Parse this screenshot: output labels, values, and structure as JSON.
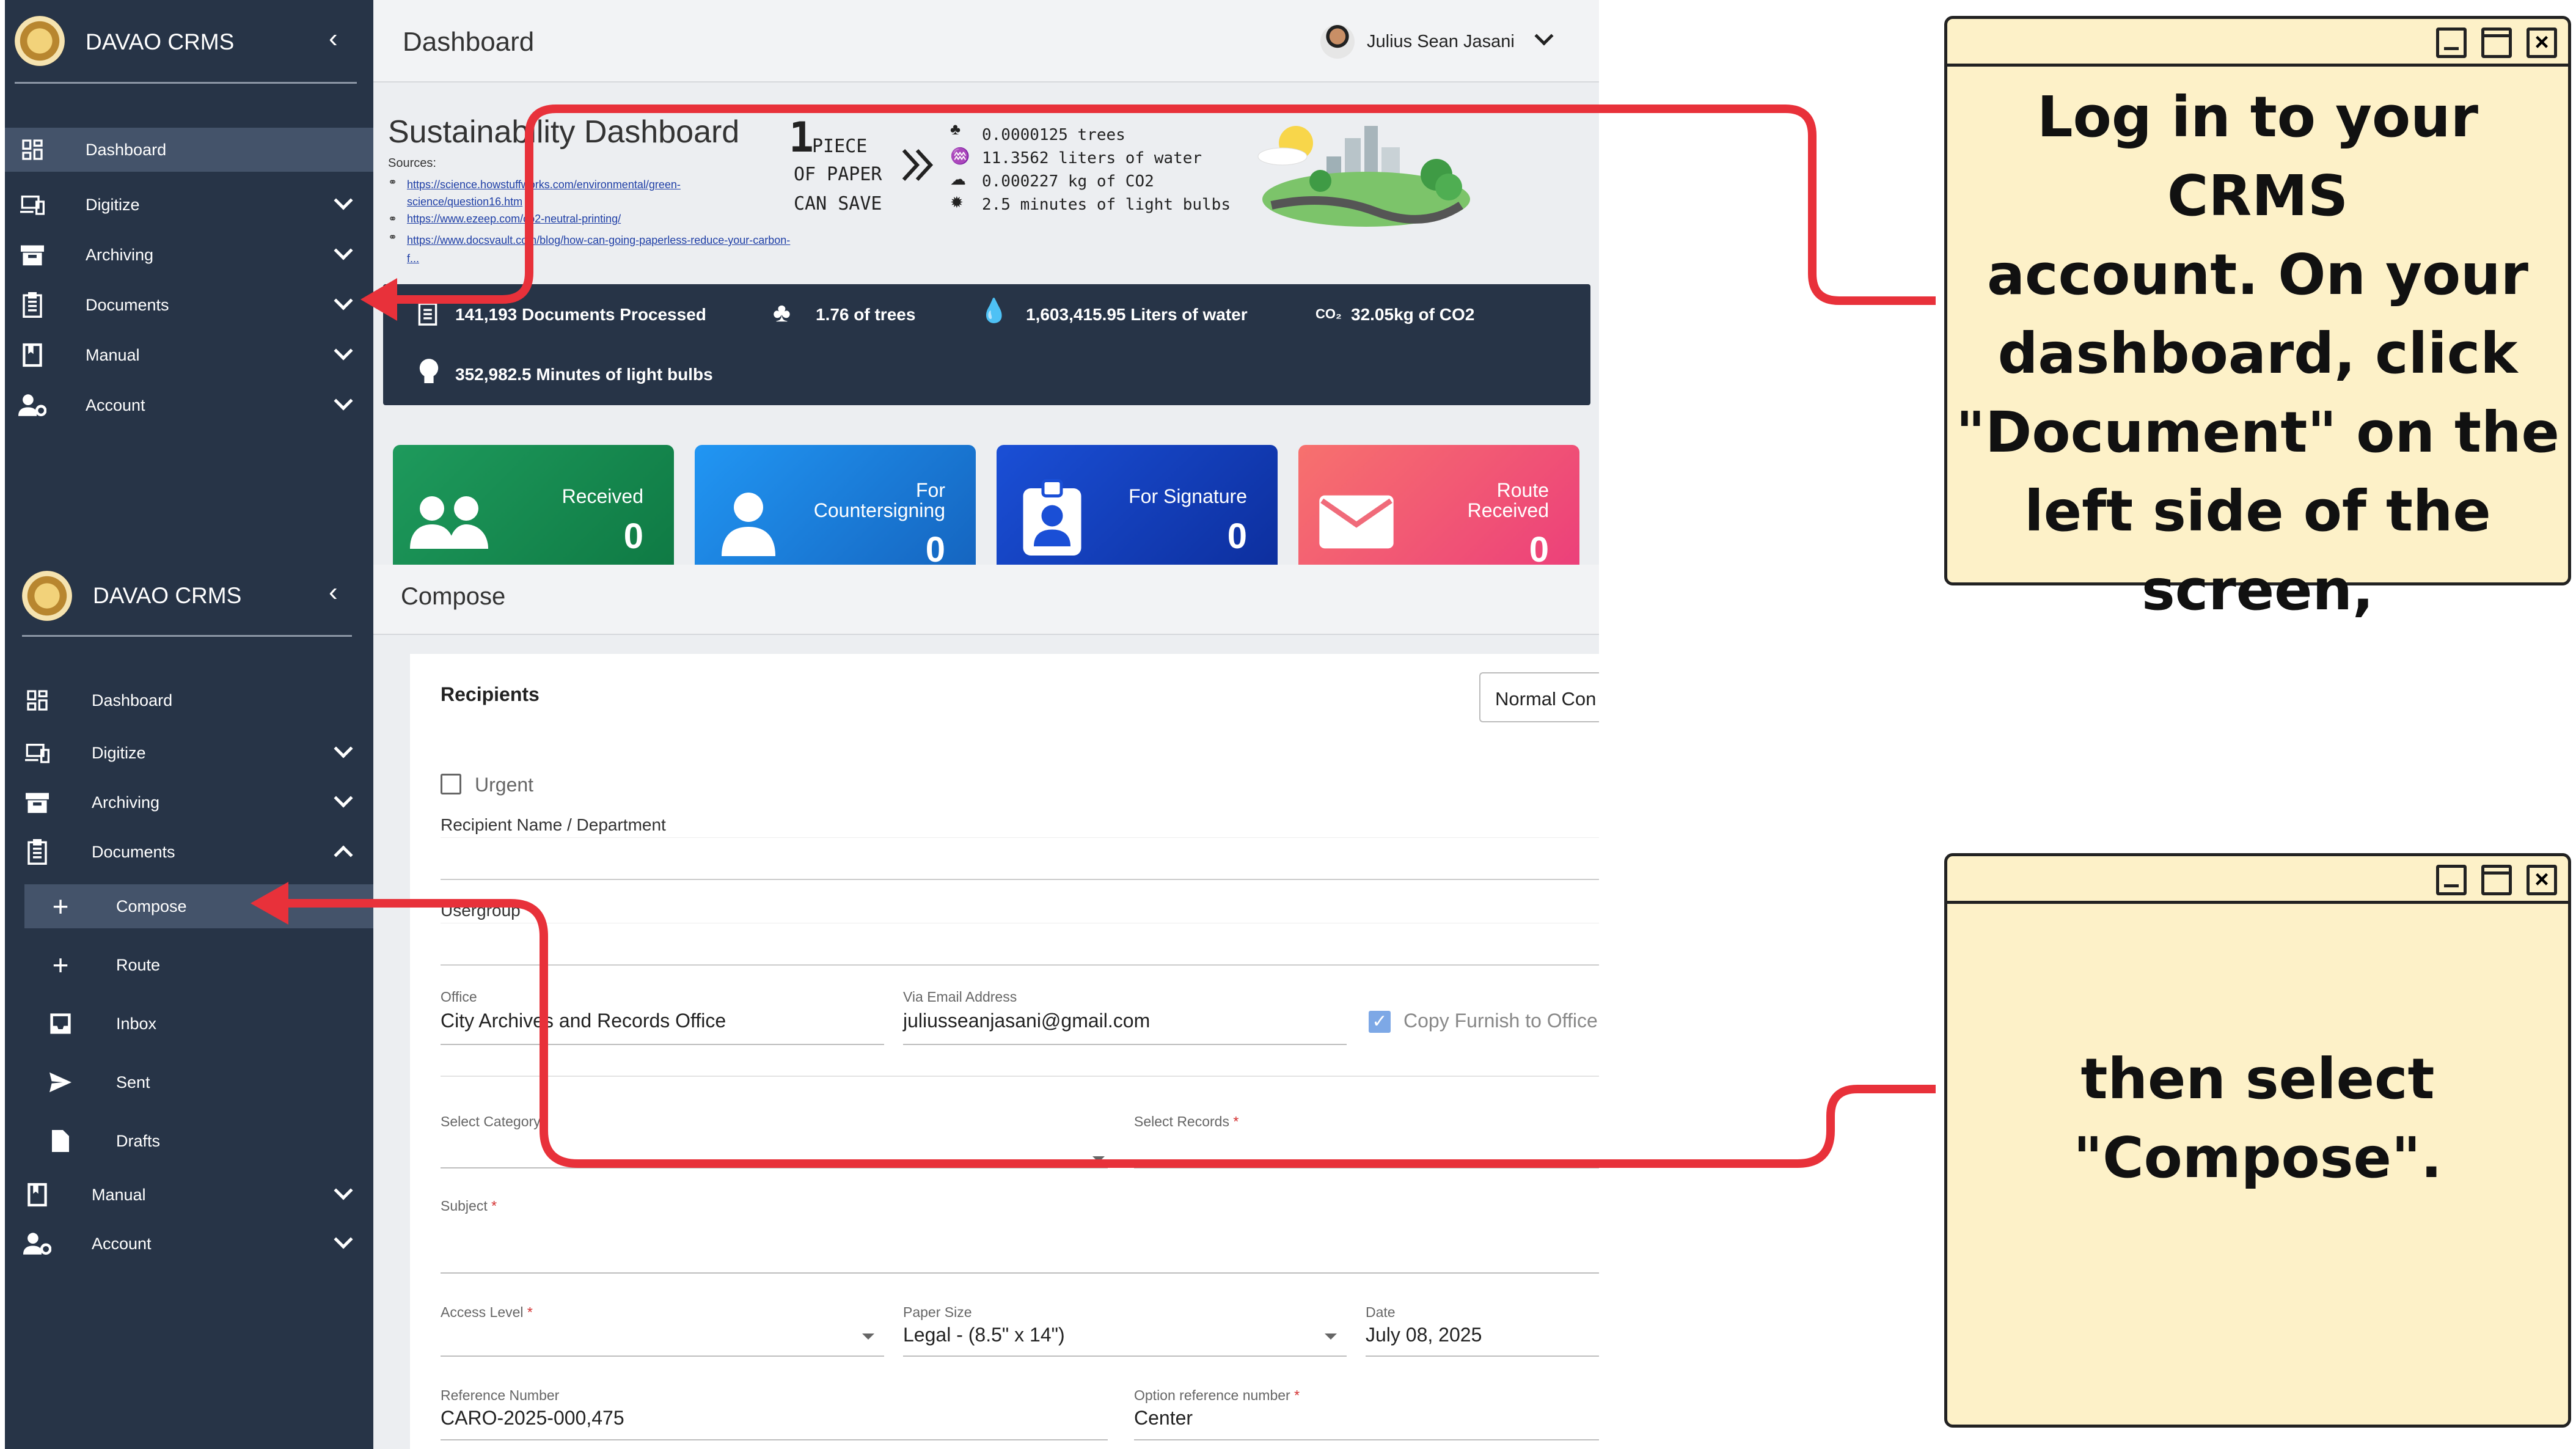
{
  "app": {
    "brand": "DAVAO CRMS",
    "collapse_symbol": "‹"
  },
  "sidebar_top": {
    "items": [
      {
        "label": "Dashboard",
        "icon": "dashboard-icon",
        "active": true
      },
      {
        "label": "Digitize",
        "icon": "devices-icon"
      },
      {
        "label": "Archiving",
        "icon": "archive-icon"
      },
      {
        "label": "Documents",
        "icon": "document-list-icon"
      },
      {
        "label": "Manual",
        "icon": "book-icon"
      },
      {
        "label": "Account",
        "icon": "account-settings-icon"
      }
    ]
  },
  "sidebar_bottom": {
    "items": [
      {
        "label": "Dashboard"
      },
      {
        "label": "Digitize"
      },
      {
        "label": "Archiving"
      },
      {
        "label": "Documents"
      },
      {
        "label": "Compose",
        "active": true
      },
      {
        "label": "Route"
      },
      {
        "label": "Inbox"
      },
      {
        "label": "Sent"
      },
      {
        "label": "Drafts"
      },
      {
        "label": "Manual"
      },
      {
        "label": "Account"
      }
    ]
  },
  "header": {
    "title": "Dashboard",
    "user_name": "Julius Sean Jasani"
  },
  "sustainability": {
    "title": "Sustainability Dashboard",
    "sources_label": "Sources:",
    "sources": [
      "https://science.howstuffworks.com/environmental/green-science/question16.htm",
      "https://www.ezeep.com/co2-neutral-printing/",
      "https://www.docsvault.com/blog/how-can-going-paperless-reduce-your-carbon-f..."
    ],
    "piece_number": "1",
    "piece_lines": [
      "PIECE",
      "OF PAPER",
      "CAN SAVE"
    ],
    "saves": [
      "0.0000125 trees",
      "11.3562 liters of water",
      "0.000227 kg of CO2",
      "2.5 minutes of light bulbs"
    ],
    "stats": {
      "documents": "141,193 Documents Processed",
      "trees": "1.76 of trees",
      "water": "1,603,415.95 Liters of water",
      "co2_prefix": "CO₂",
      "co2": "32.05kg of CO2",
      "light": "352,982.5 Minutes of light bulbs"
    }
  },
  "cards": [
    {
      "label": "Received",
      "value": "0",
      "color_from": "#1e9a5c",
      "color_to": "#0f7a44"
    },
    {
      "label": "For\nCountersigning",
      "value": "0",
      "color_from": "#2196f3",
      "color_to": "#1565c0"
    },
    {
      "label": "For Signature",
      "value": "0",
      "color_from": "#1a4fd6",
      "color_to": "#0d2f9e"
    },
    {
      "label": "Route\nReceived",
      "value": "0",
      "color_from": "#f7716e",
      "color_to": "#ec407a"
    }
  ],
  "compose": {
    "title": "Compose",
    "recipients_heading": "Recipients",
    "type_select": "Normal Con",
    "urgent_label": "Urgent",
    "recipient_label": "Recipient Name / Department",
    "usergroup_label": "Usergroup",
    "office_label": "Office",
    "office_value": "City Archives and Records Office",
    "email_label": "Via Email Address",
    "email_value": "juliusseanjasani@gmail.com",
    "copy_label": "Copy Furnish to Office",
    "category_label": "Select Category",
    "records_label": "Select Records",
    "subject_label": "Subject",
    "access_label": "Access Level",
    "paper_label": "Paper Size",
    "paper_value": "Legal - (8.5\" x 14\")",
    "date_label": "Date",
    "date_value": "July 08, 2025",
    "refnum_label": "Reference Number",
    "refnum_value": "CARO-2025-000,475",
    "optref_label": "Option reference number",
    "optref_value": "Center",
    "required_mark": "*"
  },
  "callouts": {
    "step1": [
      "Log in to your CRMS",
      "account. On your",
      "dashboard, click",
      "\"Document\" on the",
      "left side of the",
      "screen,"
    ],
    "step2": [
      "then select",
      "\"Compose\"."
    ]
  },
  "accent_colors": {
    "arrow": "#e8313a",
    "sidebar": "#273447",
    "note": "#fdf1c8"
  }
}
